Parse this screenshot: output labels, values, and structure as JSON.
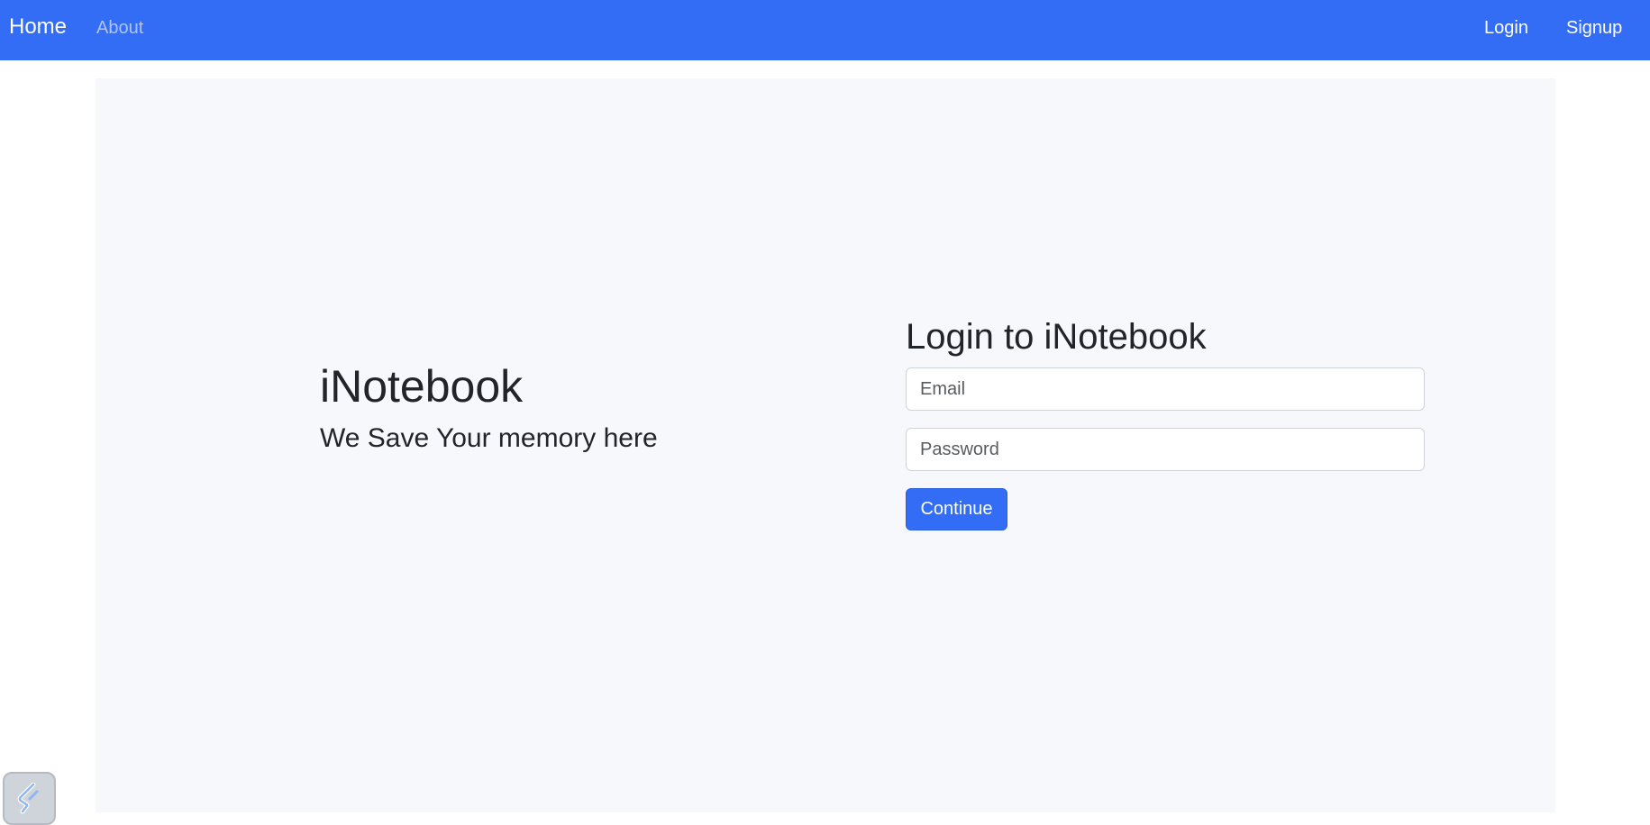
{
  "navbar": {
    "home_label": "Home",
    "about_label": "About",
    "login_label": "Login",
    "signup_label": "Signup",
    "background_color": "#336cf5"
  },
  "hero": {
    "title": "iNotebook",
    "subtitle": "We Save Your memory here"
  },
  "login_form": {
    "title": "Login to iNotebook",
    "email_placeholder": "Email",
    "password_placeholder": "Password",
    "submit_label": "Continue",
    "accent_color": "#336cf5"
  },
  "panel": {
    "background_color": "#f7f8fc"
  },
  "corner_widget": {
    "icon": "extension-icon"
  }
}
